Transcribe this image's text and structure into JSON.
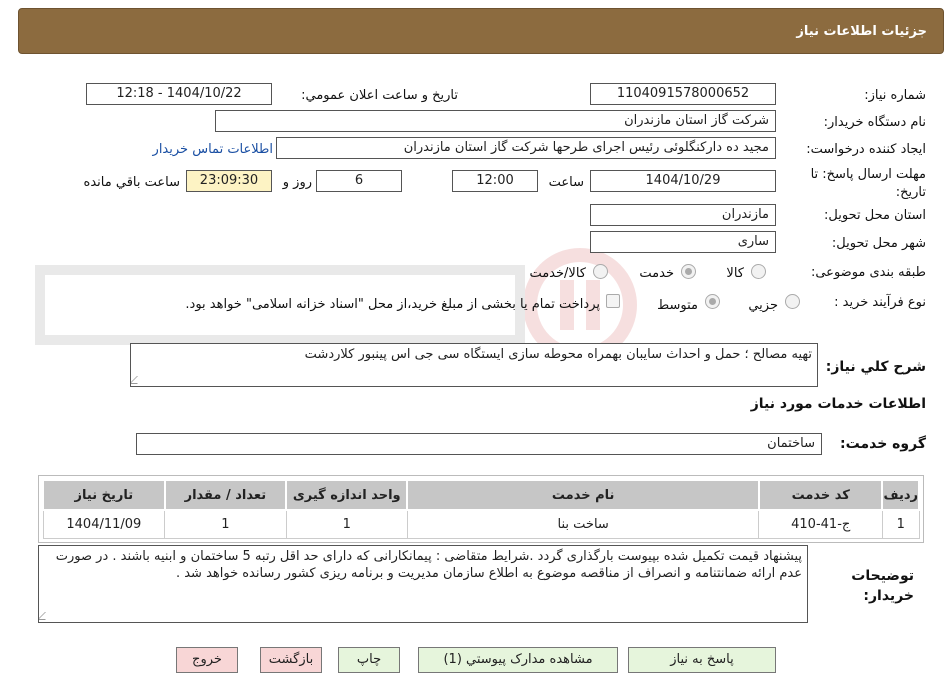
{
  "header": {
    "title": "جزئیات اطلاعات نیاز"
  },
  "form": {
    "need_number_label": "شماره نیاز:",
    "need_number": "1104091578000652",
    "announce_label": "تاریخ و ساعت اعلان عمومي:",
    "announce_value": "1404/10/22 - 12:18",
    "buyer_org_label": "نام دستگاه خريدار:",
    "buyer_org": "شرکت گاز استان مازندران",
    "creator_label": "ایجاد کننده درخواست:",
    "creator": "مجید ده دارکنگلوئی رئیس اجرای طرحها شرکت گاز استان مازندران",
    "contact_link": "اطلاعات تماس خريدار",
    "deadline_label": "مهلت ارسال پاسخ: تا تاریخ:",
    "deadline_date": "1404/10/29",
    "time_label": "ساعت",
    "deadline_time": "12:00",
    "days_value": "6",
    "days_label": "روز و",
    "remaining_time": "23:09:30",
    "remaining_label": "ساعت باقي مانده",
    "province_label": "استان محل تحویل:",
    "province": "مازندران",
    "city_label": "شهر محل تحویل:",
    "city": "ساری",
    "category_label": "طبقه بندی موضوعی:",
    "category_options": [
      "کالا",
      "خدمت",
      "کالا/خدمت"
    ],
    "process_label": "نوع فرآیند خرید :",
    "process_options": [
      "جزيي",
      "متوسط"
    ],
    "payment_note": "پرداخت تمام یا بخشی از مبلغ خرید،از محل \"اسناد خزانه اسلامی\" خواهد بود.",
    "description_label": "شرح کلي نیاز:",
    "description": "تهیه مصالح ؛ حمل و احداث سایبان بهمراه محوطه سازی ایستگاه سی جی اس پینبور کلاردشت",
    "services_title": "اطلاعات خدمات مورد نیاز",
    "service_group_label": "گروه خدمت:",
    "service_group": "ساختمان"
  },
  "table": {
    "headers": [
      "ردیف",
      "کد خدمت",
      "نام خدمت",
      "واحد اندازه گیری",
      "تعداد / مقدار",
      "تاریخ نیاز"
    ],
    "rows": [
      [
        "1",
        "ج-41-410",
        "ساخت بنا",
        "1",
        "1",
        "1404/11/09"
      ]
    ]
  },
  "notes": {
    "label_line1": "توضیحات",
    "label_line2": "خریدار:",
    "text": "پیشنهاد قیمت تکمیل شده بپیوست  بارگذاری گردد .شرایط متقاضی : پیمانکارانی که دارای حد اقل رتبه 5 ساختمان و ابنیه باشند . در صورت عدم ارائه ضمانتنامه و انصراف از مناقصه موضوع به اطلاع سازمان مدیریت و برنامه ریزی کشور رسانده خواهد شد ."
  },
  "buttons": {
    "reply": "پاسخ به نياز",
    "attachments": "مشاهده مدارک پيوستي (1)",
    "print": "چاپ",
    "back": "بازگشت",
    "exit": "خروج"
  },
  "colors": {
    "header_bg": "#8c6b3f",
    "link": "#1a4fa3",
    "highlight": "#fdf3c4",
    "green_button": "#e6f5dc",
    "pink_button": "#f8d6d6"
  }
}
